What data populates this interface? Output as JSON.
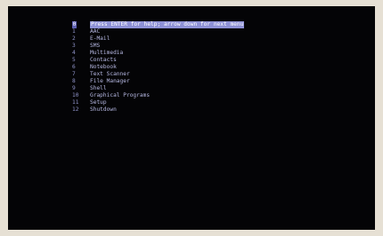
{
  "menu": {
    "header": {
      "number": "0",
      "text": "Press ENTER for help; arrow down for next menu"
    },
    "items": [
      {
        "number": "1",
        "label": "AAC"
      },
      {
        "number": "2",
        "label": "E-Mail"
      },
      {
        "number": "3",
        "label": "SMS"
      },
      {
        "number": "4",
        "label": "Multimedia"
      },
      {
        "number": "5",
        "label": "Contacts"
      },
      {
        "number": "6",
        "label": "Notebook"
      },
      {
        "number": "7",
        "label": "Text Scanner"
      },
      {
        "number": "8",
        "label": "File Manager"
      },
      {
        "number": "9",
        "label": "Shell"
      },
      {
        "number": "10",
        "label": "Graphical Programs"
      },
      {
        "number": "11",
        "label": "Setup"
      },
      {
        "number": "12",
        "label": "Shutdown"
      }
    ]
  },
  "colors": {
    "screen_background": "#040406",
    "highlight": "#8e91d6",
    "text": "#b6b8e2"
  }
}
